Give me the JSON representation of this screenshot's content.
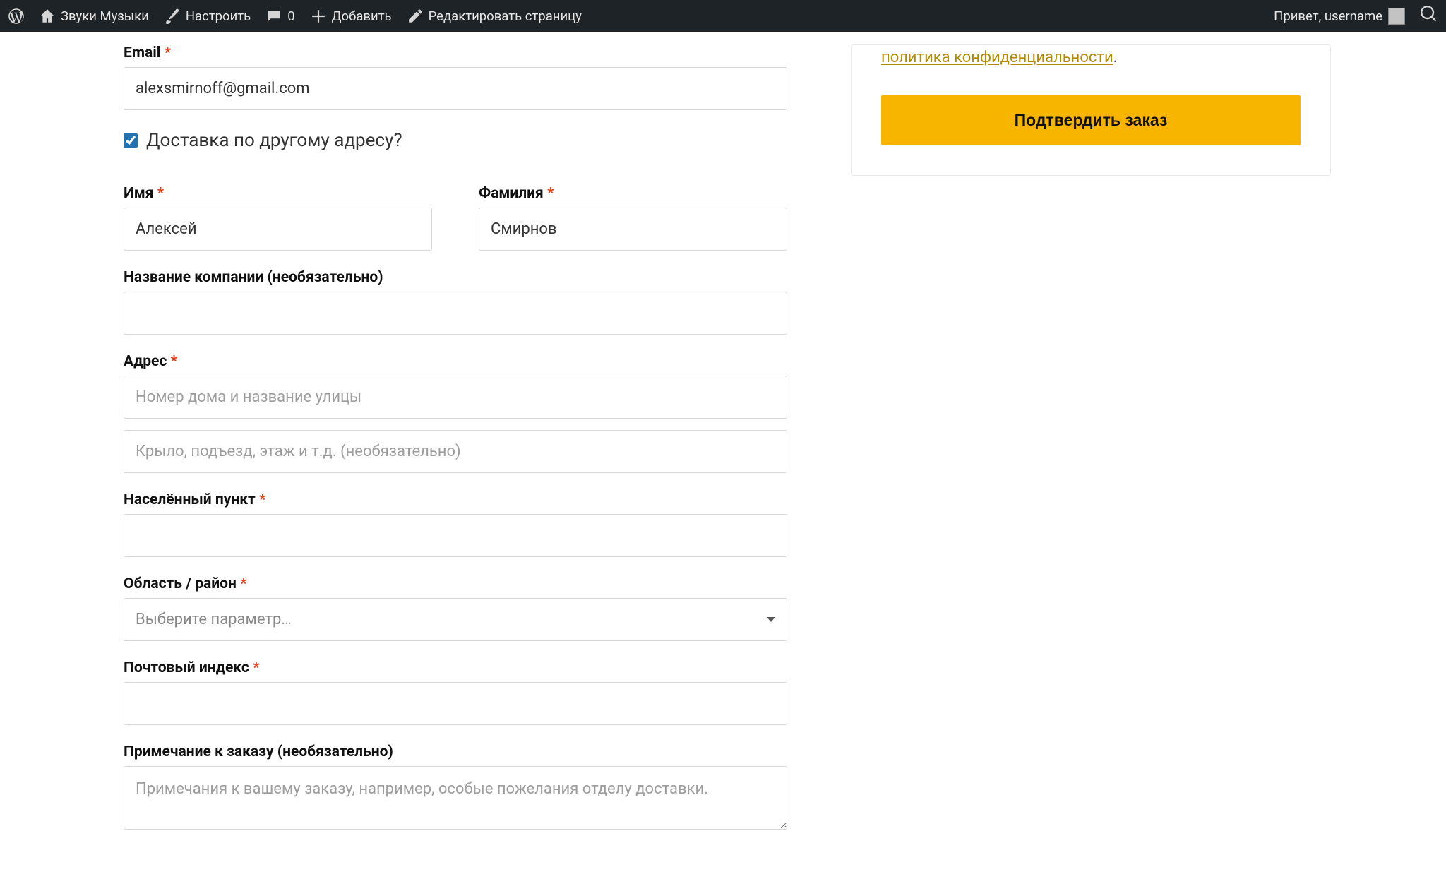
{
  "adminbar": {
    "site_name": "Звуки Музыки",
    "customize": "Настроить",
    "comments_count": "0",
    "add_new": "Добавить",
    "edit_page": "Редактировать страницу",
    "greeting": "Привет, username"
  },
  "form": {
    "email_label": "Email",
    "email_value": "alexsmirnoff@gmail.com",
    "ship_diff_label": "Доставка по другому адресу?",
    "first_name_label": "Имя",
    "first_name_value": "Алексей",
    "last_name_label": "Фамилия",
    "last_name_value": "Смирнов",
    "company_label": "Название компании (необязательно)",
    "address_label": "Адрес",
    "address1_placeholder": "Номер дома и название улицы",
    "address2_placeholder": "Крыло, подъезд, этаж и т.д. (необязательно)",
    "city_label": "Населённый пункт",
    "region_label": "Область / район",
    "region_placeholder": "Выберите параметр…",
    "postcode_label": "Почтовый индекс",
    "notes_label": "Примечание к заказу (необязательно)",
    "notes_placeholder": "Примечания к вашему заказу, например, особые пожелания отделу доставки."
  },
  "sidebar": {
    "policy_link_text": "политика конфиденциальности",
    "policy_suffix": ".",
    "confirm_label": "Подтвердить заказ"
  }
}
